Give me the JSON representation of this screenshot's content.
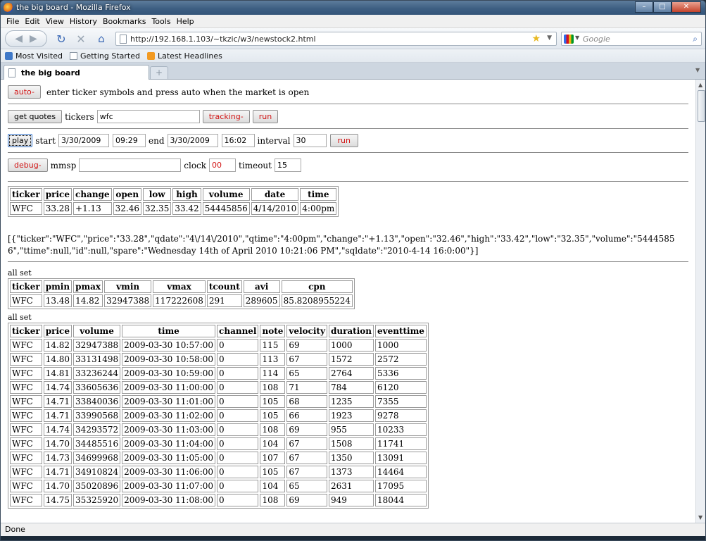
{
  "window": {
    "title": "the big board - Mozilla Firefox",
    "buttons": {
      "minimize": "–",
      "maximize": "□",
      "close": "✕"
    }
  },
  "menu": [
    "File",
    "Edit",
    "View",
    "History",
    "Bookmarks",
    "Tools",
    "Help"
  ],
  "nav": {
    "url": "http://192.168.1.103/~tkzic/w3/newstock2.html",
    "search_placeholder": "Google"
  },
  "bookmarks": [
    "Most Visited",
    "Getting Started",
    "Latest Headlines"
  ],
  "tab": {
    "label": "the big board",
    "new_tab": "+"
  },
  "controls": {
    "auto_label": "auto-",
    "auto_hint": "enter ticker symbols and press auto when the market is open",
    "getquotes_label": "get quotes",
    "tickers_label": "tickers",
    "tickers_value": "wfc",
    "tracking_label": "tracking-",
    "run_label": "run",
    "play_label": "play",
    "start_label": "start",
    "start_date": "3/30/2009",
    "start_time": "09:29",
    "end_label": "end",
    "end_date": "3/30/2009",
    "end_time": "16:02",
    "interval_label": "interval",
    "interval_value": "30",
    "debug_label": "debug-",
    "mmsp_label": "mmsp",
    "mmsp_value": "",
    "clock_label": "clock",
    "clock_value": "00",
    "timeout_label": "timeout",
    "timeout_value": "15"
  },
  "quote_table": {
    "headers": [
      "ticker",
      "price",
      "change",
      "open",
      "low",
      "high",
      "volume",
      "date",
      "time"
    ],
    "rows": [
      [
        "WFC",
        "33.28",
        "+1.13",
        "32.46",
        "32.35",
        "33.42",
        "54445856",
        "4/14/2010",
        "4:00pm"
      ]
    ]
  },
  "json_text": "[{\"ticker\":\"WFC\",\"price\":\"33.28\",\"qdate\":\"4\\/14\\/2010\",\"qtime\":\"4:00pm\",\"change\":\"+1.13\",\"open\":\"32.46\",\"high\":\"33.42\",\"low\":\"32.35\",\"volume\":\"54445856\",\"ttime\":null,\"id\":null,\"spare\":\"Wednesday 14th of April 2010 10:21:06 PM\",\"sqldate\":\"2010-4-14 16:0:00\"}]",
  "status1": "all set",
  "stats_table": {
    "headers": [
      "ticker",
      "pmin",
      "pmax",
      "vmin",
      "vmax",
      "tcount",
      "avi",
      "cpn"
    ],
    "rows": [
      [
        "WFC",
        "13.48",
        "14.82",
        "32947388",
        "117222608",
        "291",
        "289605",
        "85.8208955224"
      ]
    ]
  },
  "status2": "all set",
  "events_table": {
    "headers": [
      "ticker",
      "price",
      "volume",
      "time",
      "channel",
      "note",
      "velocity",
      "duration",
      "eventtime"
    ],
    "rows": [
      [
        "WFC",
        "14.82",
        "32947388",
        "2009-03-30 10:57:00",
        "0",
        "115",
        "69",
        "1000",
        "1000"
      ],
      [
        "WFC",
        "14.80",
        "33131498",
        "2009-03-30 10:58:00",
        "0",
        "113",
        "67",
        "1572",
        "2572"
      ],
      [
        "WFC",
        "14.81",
        "33236244",
        "2009-03-30 10:59:00",
        "0",
        "114",
        "65",
        "2764",
        "5336"
      ],
      [
        "WFC",
        "14.74",
        "33605636",
        "2009-03-30 11:00:00",
        "0",
        "108",
        "71",
        "784",
        "6120"
      ],
      [
        "WFC",
        "14.71",
        "33840036",
        "2009-03-30 11:01:00",
        "0",
        "105",
        "68",
        "1235",
        "7355"
      ],
      [
        "WFC",
        "14.71",
        "33990568",
        "2009-03-30 11:02:00",
        "0",
        "105",
        "66",
        "1923",
        "9278"
      ],
      [
        "WFC",
        "14.74",
        "34293572",
        "2009-03-30 11:03:00",
        "0",
        "108",
        "69",
        "955",
        "10233"
      ],
      [
        "WFC",
        "14.70",
        "34485516",
        "2009-03-30 11:04:00",
        "0",
        "104",
        "67",
        "1508",
        "11741"
      ],
      [
        "WFC",
        "14.73",
        "34699968",
        "2009-03-30 11:05:00",
        "0",
        "107",
        "67",
        "1350",
        "13091"
      ],
      [
        "WFC",
        "14.71",
        "34910824",
        "2009-03-30 11:06:00",
        "0",
        "105",
        "67",
        "1373",
        "14464"
      ],
      [
        "WFC",
        "14.70",
        "35020896",
        "2009-03-30 11:07:00",
        "0",
        "104",
        "65",
        "2631",
        "17095"
      ],
      [
        "WFC",
        "14.75",
        "35325920",
        "2009-03-30 11:08:00",
        "0",
        "108",
        "69",
        "949",
        "18044"
      ]
    ]
  },
  "statusbar": "Done"
}
